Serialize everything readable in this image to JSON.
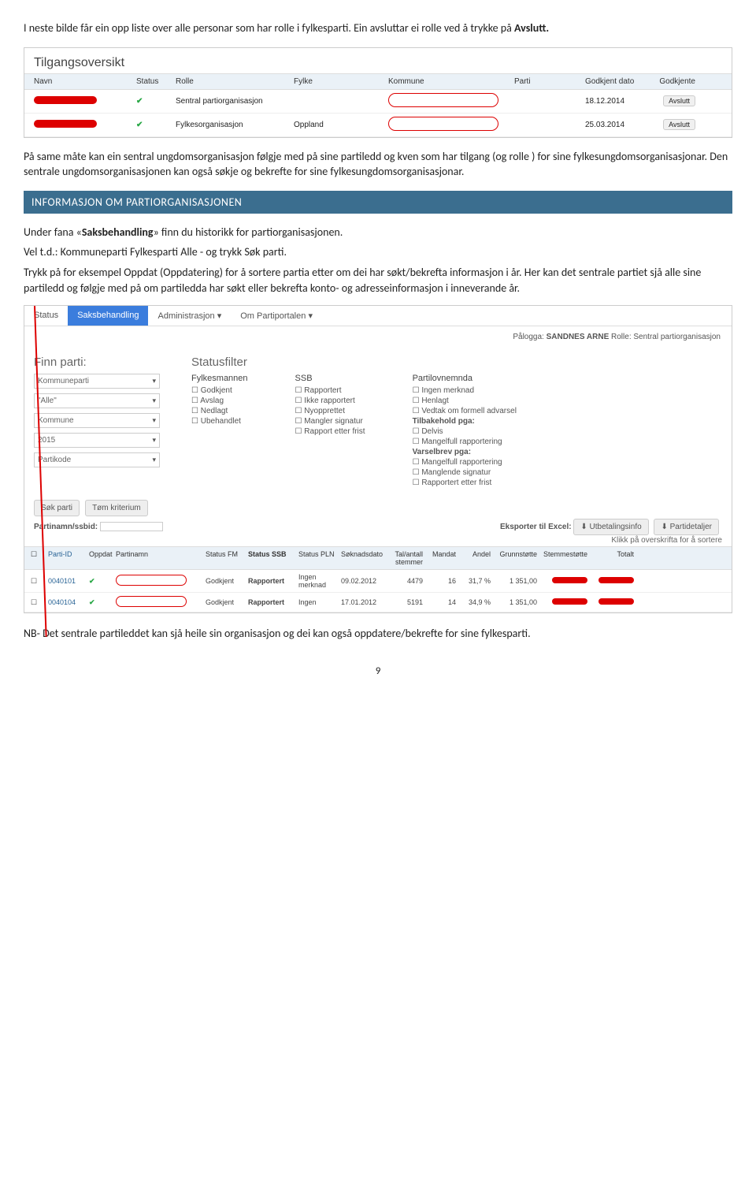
{
  "intro": {
    "p1_a": "I neste bilde får ein opp liste over alle personar som har rolle i fylkesparti. Ein avsluttar ei rolle ved å trykke på ",
    "p1_b": "Avslutt."
  },
  "access_panel": {
    "title": "Tilgangsoversikt",
    "headers": {
      "navn": "Navn",
      "status": "Status",
      "rolle": "Rolle",
      "fylke": "Fylke",
      "kommune": "Kommune",
      "parti": "Parti",
      "dato": "Godkjent dato",
      "godkjente": "Godkjente"
    },
    "rows": [
      {
        "rolle": "Sentral partiorganisasjon",
        "fylke": "",
        "dato": "18.12.2014",
        "btn": "Avslutt"
      },
      {
        "rolle": "Fylkesorganisasjon",
        "fylke": "Oppland",
        "dato": "25.03.2014",
        "btn": "Avslutt"
      }
    ]
  },
  "mid": {
    "p2": "På same måte kan ein sentral ungdomsorganisasjon følgje med på sine partiledd og kven som har  tilgang (og rolle ) for sine fylkesungdomsorganisasjonar. Den sentrale ungdomsorganisasjonen kan også søkje og bekrefte for sine fylkesungdomsorganisasjonar."
  },
  "section_bar": "INFORMASJON OM PARTIORGANISASJONEN",
  "info": {
    "p3_a": "Under fana «",
    "p3_b": "Saksbehandling",
    "p3_c": "»  finn du historikk for partiorganisasjonen.",
    "p4": "Vel t.d.: Kommuneparti Fylkesparti Alle -  og trykk Søk parti.",
    "p5": "Trykk på for eksempel Oppdat (Oppdatering)  for å sortere partia etter om dei har søkt/bekrefta informasjon i år. Her kan det sentrale partiet sjå alle sine partiledd og følgje med på om partiledda  har søkt eller bekrefta konto- og adresseinformasjon i inneverande år."
  },
  "app": {
    "tabs": {
      "t1": "Status",
      "t2": "Saksbehandling",
      "t3": "Administrasjon",
      "t4": "Om Partiportalen"
    },
    "login_a": "Pålogga: ",
    "login_b": "SANDNES ARNE",
    "login_c": "   Rolle: Sentral partiorganisasjon",
    "finn_title": "Finn parti:",
    "selects": {
      "s1": "Kommuneparti",
      "s2": "\"Alle\"",
      "s3": "Kommune",
      "s4": "2015",
      "s5": "Partikode"
    },
    "status_title": "Statusfilter",
    "fm": {
      "h": "Fylkesmannen",
      "o1": "Godkjent",
      "o2": "Avslag",
      "o3": "Nedlagt",
      "o4": "Ubehandlet"
    },
    "ssb": {
      "h": "SSB",
      "o1": "Rapportert",
      "o2": "Ikke rapportert",
      "o3": "Nyopprettet",
      "o4": "Mangler signatur",
      "o5": "Rapport etter frist"
    },
    "pln": {
      "h": "Partilovnemnda",
      "o1": "Ingen merknad",
      "o2": "Henlagt",
      "o3": "Vedtak om formell advarsel",
      "sub1": "Tilbakehold pga:",
      "o4": "Delvis",
      "o5": "Mangelfull rapportering",
      "sub2": "Varselbrev pga:",
      "o6": "Mangelfull rapportering",
      "o7": "Manglende signatur",
      "o8": "Rapportert etter frist"
    },
    "btn_sok": "Søk parti",
    "btn_tom": "Tøm kriterium",
    "psearch_label": "Partinamn/ssbid:",
    "export_label": "Eksporter til Excel:",
    "export_b1": "Utbetalingsinfo",
    "export_b2": "Partidetaljer",
    "hint": "Klikk på overskrifta for å sortere",
    "thead": {
      "c0": "",
      "c1": "Parti-ID",
      "c2": "Oppdat.",
      "c3": "Partinamn",
      "c4": "Status FM",
      "c5": "Status SSB",
      "c6": "Status PLN",
      "c7": "Søknadsdato",
      "c8": "Tal/antall stemmer",
      "c9": "Mandat",
      "c10": "Andel",
      "c11": "Grunnstøtte",
      "c12": "Stemmestøtte",
      "c13": "Totalt"
    },
    "rows": [
      {
        "id": "0040101",
        "sfm": "Godkjent",
        "sssb": "Rapportert",
        "spln": "Ingen merknad",
        "dato": "09.02.2012",
        "tal": "4479",
        "man": "16",
        "and": "31,7 %",
        "grn": "1 351,00"
      },
      {
        "id": "0040104",
        "sfm": "Godkjent",
        "sssb": "Rapportert",
        "spln": "Ingen",
        "dato": "17.01.2012",
        "tal": "5191",
        "man": "14",
        "and": "34,9 %",
        "grn": "1 351,00"
      }
    ]
  },
  "closing": {
    "p6": "NB- Det  sentrale partileddet kan sjå heile sin organisasjon og dei kan også oppdatere/bekrefte for sine fylkesparti."
  },
  "pagenum": "9"
}
